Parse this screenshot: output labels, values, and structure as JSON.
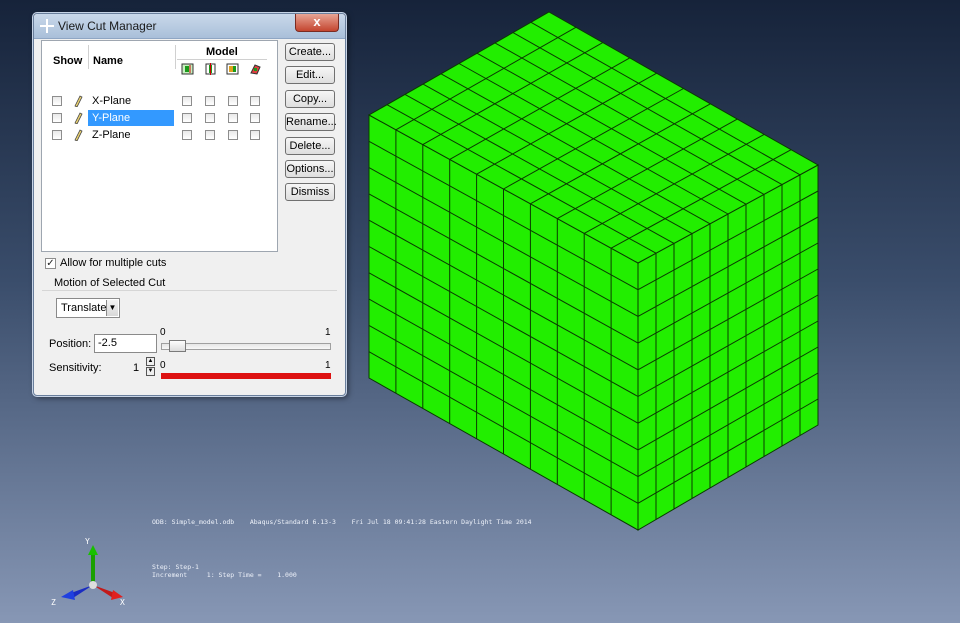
{
  "dialog": {
    "title": "View Cut Manager",
    "close_label": "x",
    "columns": {
      "show": "Show",
      "name": "Name",
      "model": "Model"
    },
    "model_icons": [
      "translate-model-icon",
      "cut-model-icon",
      "color-model-icon",
      "deform-model-icon"
    ],
    "rows": [
      {
        "name": "X-Plane",
        "selected": false
      },
      {
        "name": "Y-Plane",
        "selected": true
      },
      {
        "name": "Z-Plane",
        "selected": false
      }
    ],
    "buttons": {
      "create": "Create...",
      "edit": "Edit...",
      "copy": "Copy...",
      "rename": "Rename...",
      "delete": "Delete...",
      "options": "Options...",
      "dismiss": "Dismiss"
    },
    "allow_multiple": {
      "label": "Allow for multiple cuts",
      "checked": true
    },
    "motion": {
      "group_label": "Motion of Selected Cut",
      "mode": "Translate",
      "position_label": "Position:",
      "position_value": "-2.5",
      "position_slider": {
        "min_label": "0",
        "max_label": "1",
        "value": 0.05
      },
      "sensitivity_label": "Sensitivity:",
      "sensitivity_value": "1",
      "sensitivity_slider": {
        "min_label": "0",
        "max_label": "1",
        "value": 1.0
      }
    }
  },
  "viewport": {
    "mesh_color": "#22ee00",
    "mesh_divisions": {
      "width": 10,
      "height": 10,
      "depth": 10
    },
    "info_line1": "ODB: Simple_model.odb    Abaqus/Standard 6.13-3    Fri Jul 18 09:41:28 Eastern Daylight Time 2014",
    "info_line2": "Step: Step-1",
    "info_line3": "Increment     1: Step Time =    1.000",
    "triad": {
      "x": "X",
      "y": "Y",
      "z": "Z"
    }
  }
}
